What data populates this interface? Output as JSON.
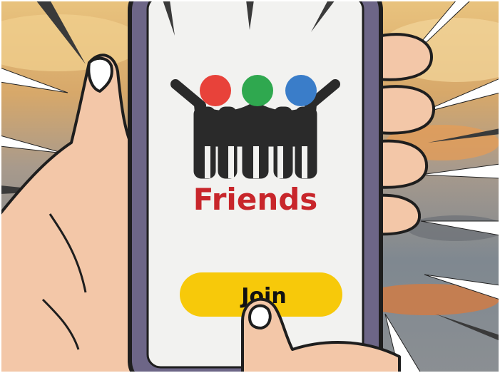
{
  "app": {
    "brand_name": "Friends",
    "logo_icon": "friends-group-logo-icon",
    "logo_dot_colors": [
      "#e8423a",
      "#2fa84f",
      "#3a7dc9"
    ],
    "brand_color": "#c8262b"
  },
  "screen": {
    "background_color": "#f2f2f0",
    "join_button": {
      "label": "Join",
      "color": "#f7c90a"
    }
  },
  "phone": {
    "frame_color": "#6d6687"
  }
}
